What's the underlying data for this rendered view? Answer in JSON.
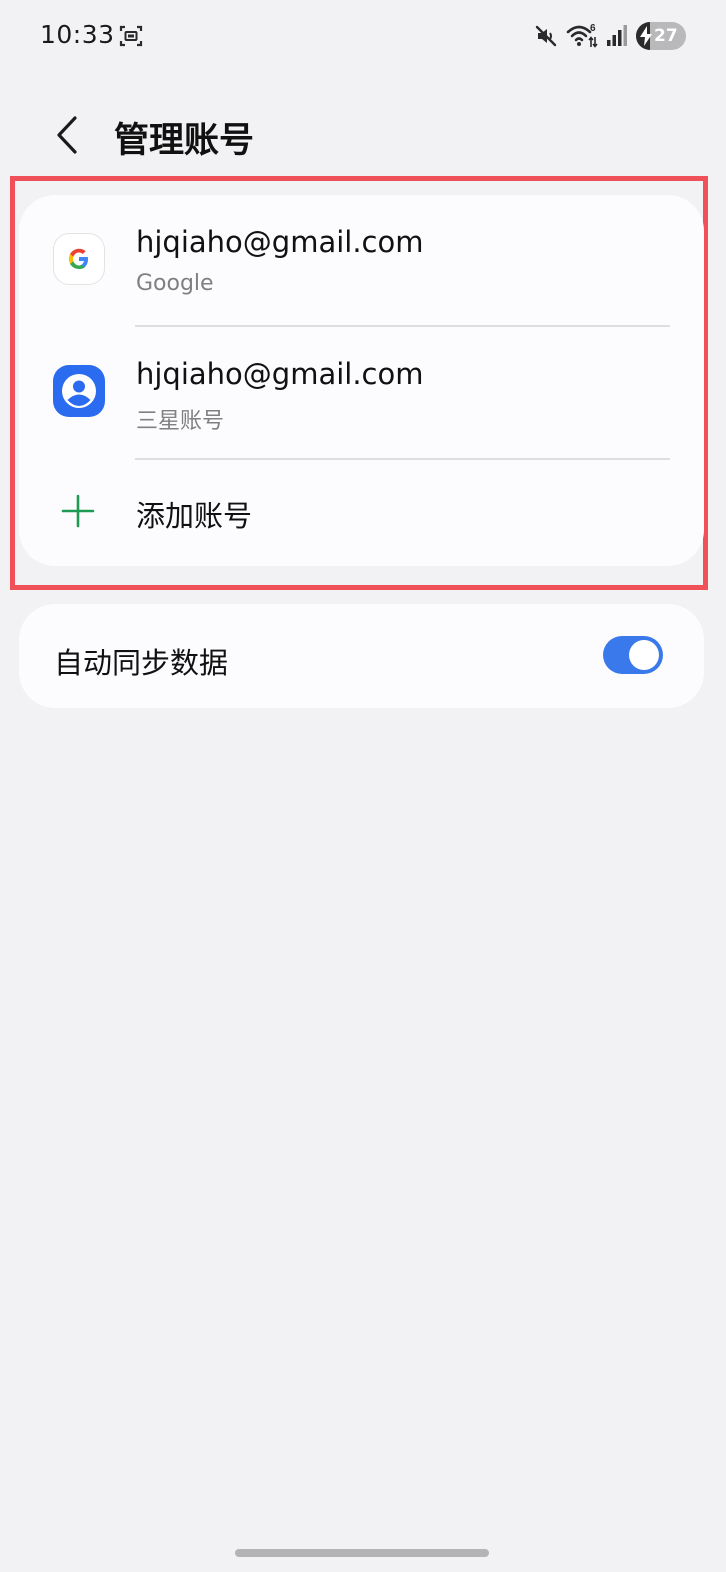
{
  "status_bar": {
    "time": "10:33",
    "icons": [
      "screen-recorder-icon",
      "mute-icon",
      "wifi-6-icon",
      "signal-icon",
      "battery-charging-icon"
    ],
    "wifi_badge": "6",
    "battery_level": "27",
    "battery_fraction": 0.27
  },
  "header": {
    "back_icon": "chevron-left-icon",
    "title": "管理账号"
  },
  "accounts": {
    "items": [
      {
        "email": "hjqiaho@gmail.com",
        "type": "Google",
        "icon": "google-logo-icon"
      },
      {
        "email": "hjqiaho@gmail.com",
        "type": "三星账号",
        "icon": "samsung-account-icon"
      }
    ],
    "add_label": "添加账号",
    "add_icon": "plus-icon",
    "accent_color": "#1e9b53"
  },
  "sync": {
    "label": "自动同步数据",
    "enabled": true,
    "toggle_color": "#3a79ec"
  },
  "highlight_color": "#f05158"
}
